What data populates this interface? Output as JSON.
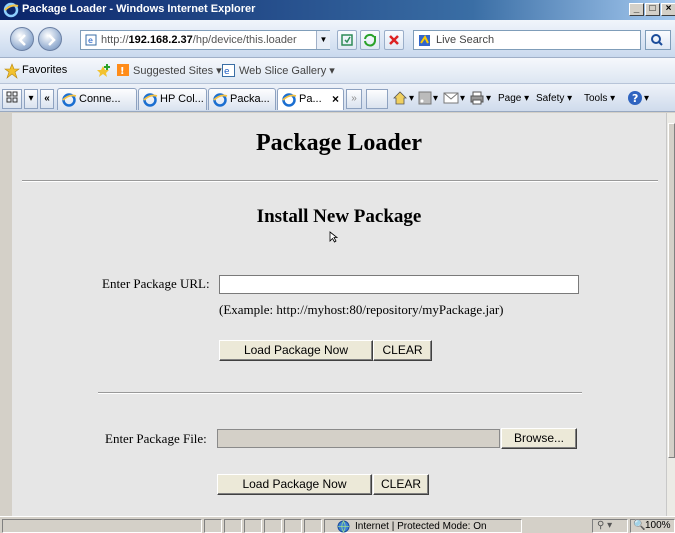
{
  "window": {
    "title": "Package Loader - Windows Internet Explorer",
    "minimize": "_",
    "maximize": "□",
    "close": "×"
  },
  "address_bar": {
    "url_prefix": "http://",
    "url_host": "192.168.2.37",
    "url_path": "/hp/device/this.loader",
    "search_placeholder": "Live Search"
  },
  "favorites_bar": {
    "favorites_label": "Favorites",
    "suggested_sites": "Suggested Sites ▾",
    "web_slice_gallery": "Web Slice Gallery ▾"
  },
  "tabs": [
    {
      "label": "Conne..."
    },
    {
      "label": "HP Col..."
    },
    {
      "label": "Packa..."
    },
    {
      "label": "Pa...",
      "close": "×"
    }
  ],
  "command_bar": {
    "page": "Page ▾",
    "safety": "Safety ▾",
    "tools": "Tools ▾",
    "quick_tabs": "«",
    "more_tabs": "»"
  },
  "page": {
    "title": "Package Loader",
    "section_title": "Install New Package",
    "url_label": "Enter Package URL:",
    "url_value": "",
    "example_text": "(Example: http://myhost:80/repository/myPackage.jar)",
    "load_button_1": "Load Package Now",
    "clear_button_1": "CLEAR",
    "file_label": "Enter Package File:",
    "browse_button": "Browse...",
    "load_button_2": "Load Package Now",
    "clear_button_2": "CLEAR"
  },
  "status_bar": {
    "zone": "Internet | Protected Mode: On",
    "zoom": "100%"
  }
}
